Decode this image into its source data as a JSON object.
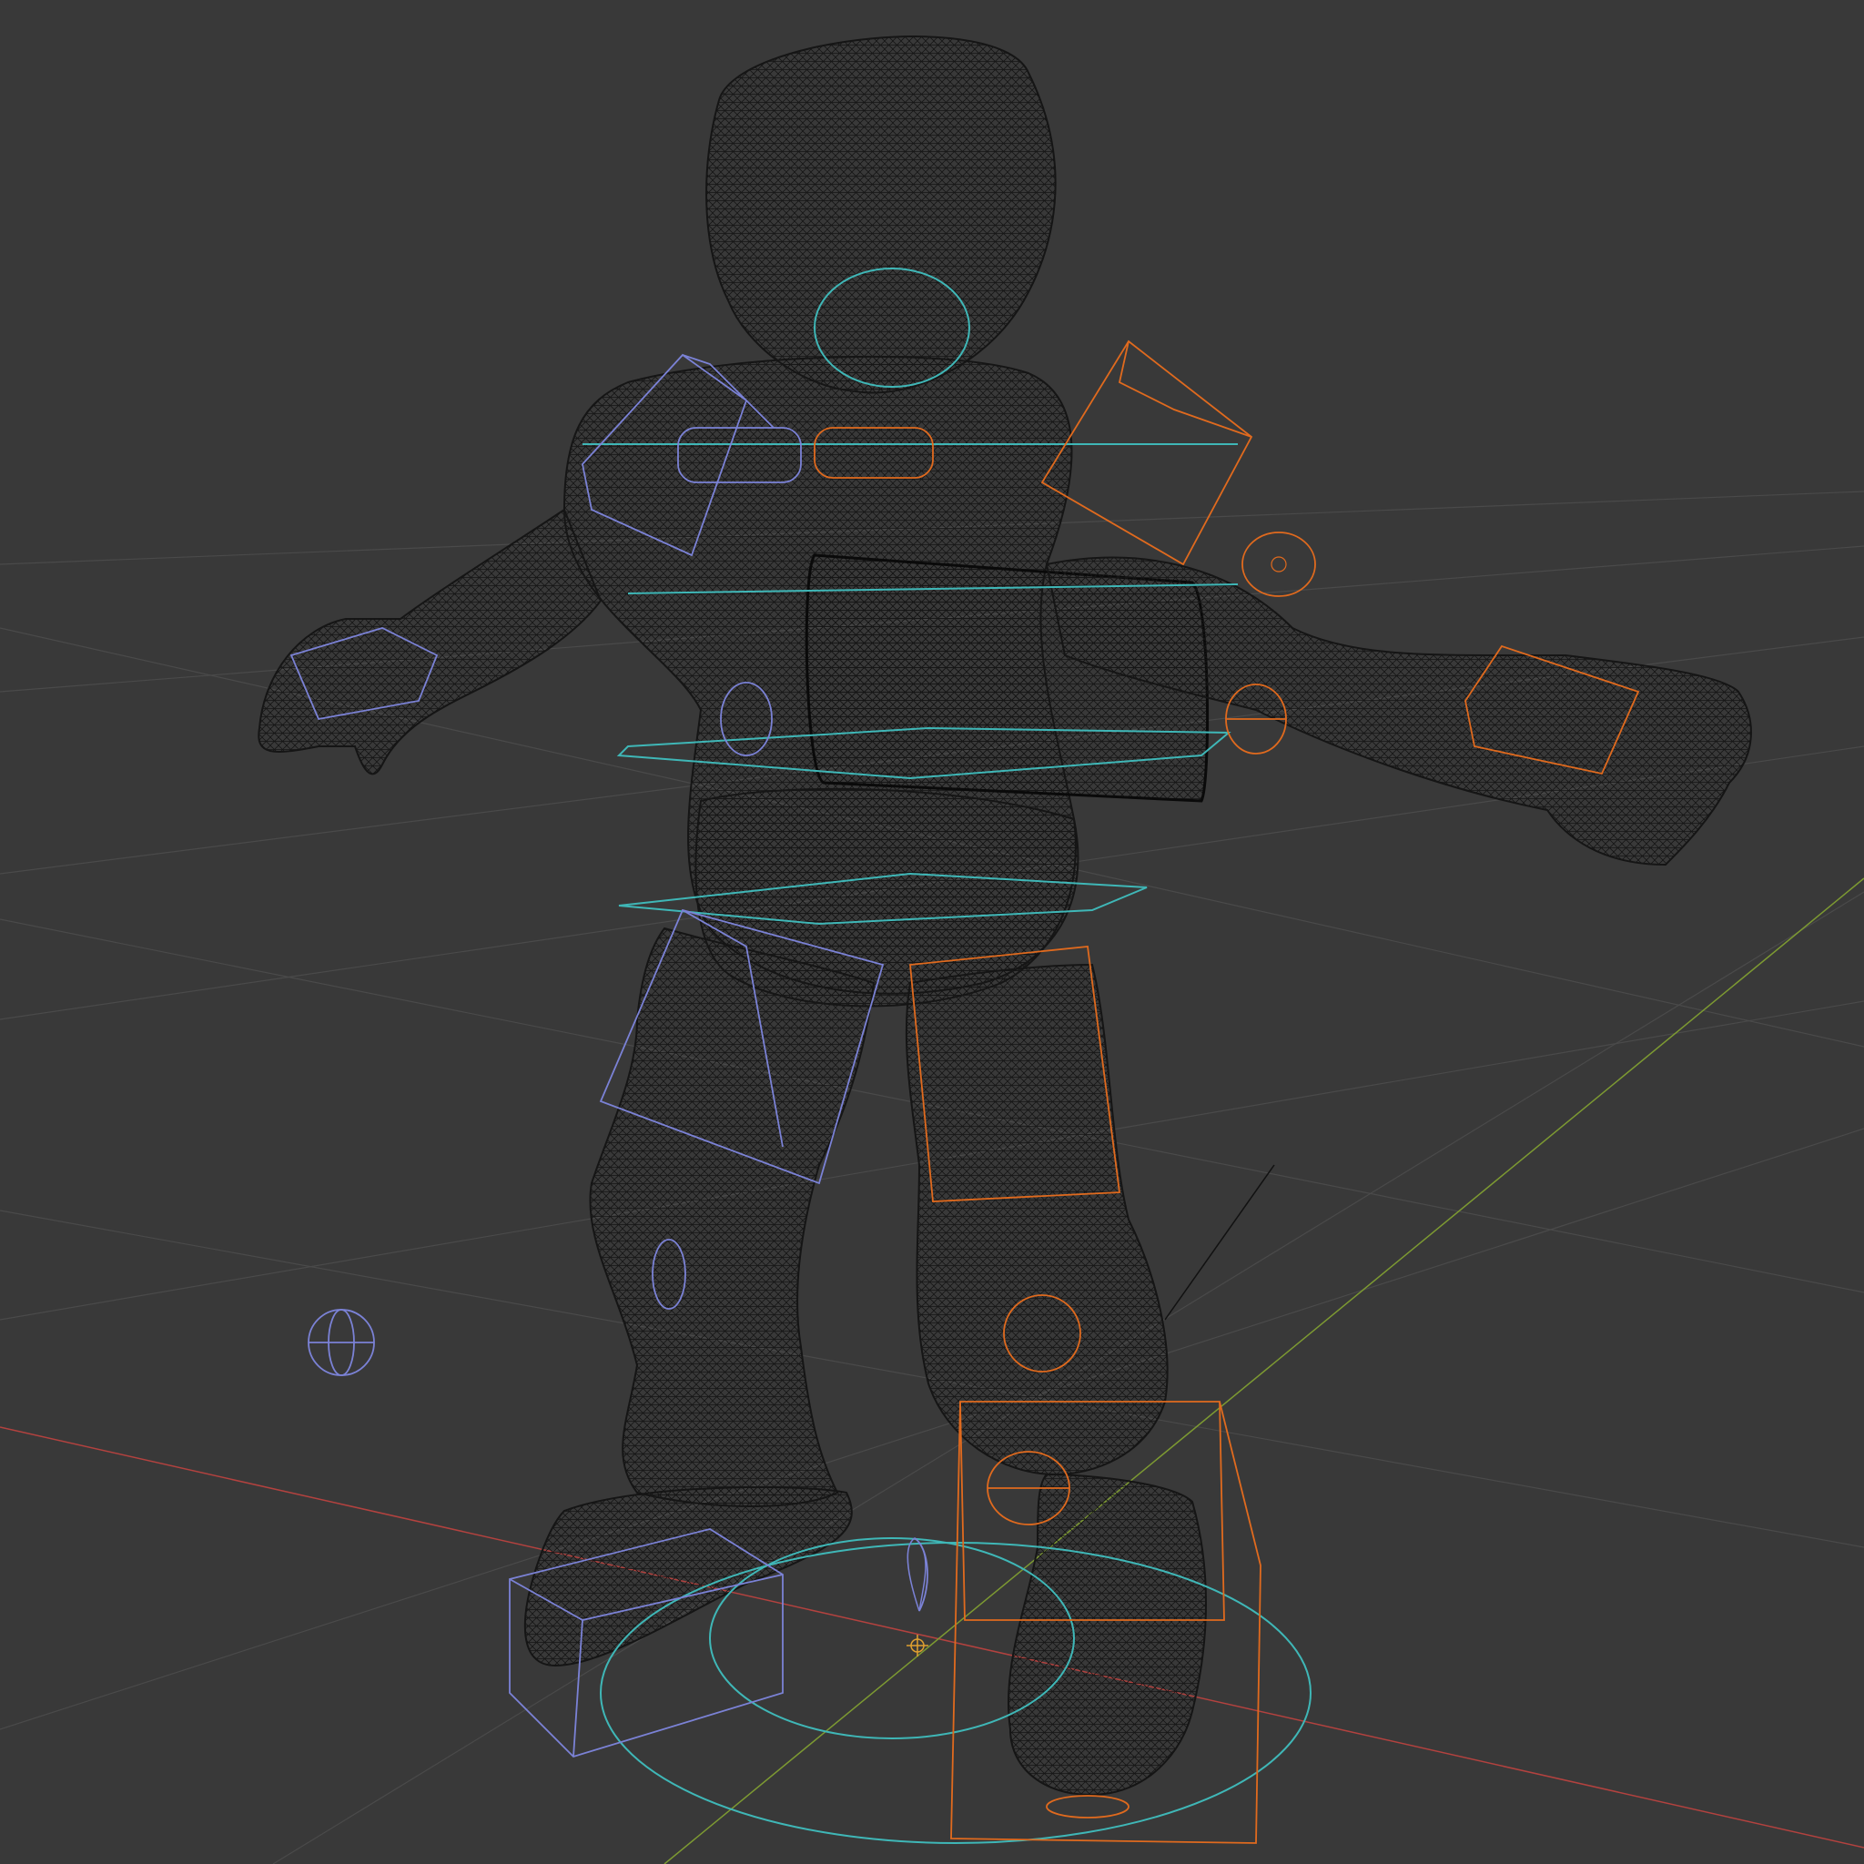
{
  "viewport": {
    "mode": "wireframe",
    "colors": {
      "background": "#393939",
      "grid": "#4a4a4a",
      "axis_x": "#b3423f",
      "axis_y": "#7d9a32",
      "mesh": "#151515",
      "controls_cyan": "#3fb7b7",
      "controls_left": "#7b82d6",
      "controls_right": "#e06a1e",
      "camera_line": "#111111"
    },
    "icons": [
      "origin-marker-icon",
      "empty-sphere-icon",
      "light-icon"
    ]
  }
}
